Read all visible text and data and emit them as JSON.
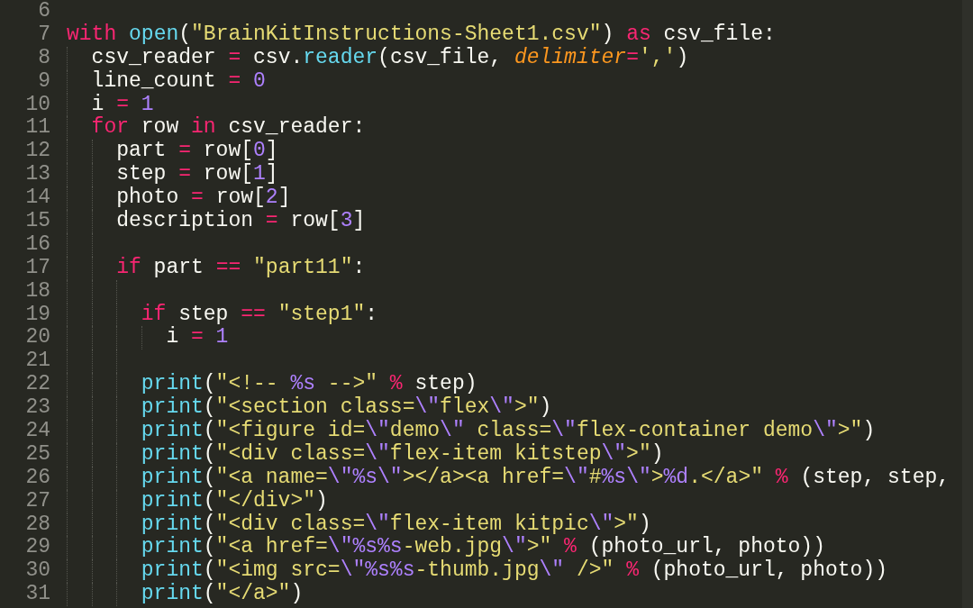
{
  "editor": {
    "lines": [
      {
        "number": "6"
      },
      {
        "number": "7",
        "tokens": [
          {
            "kind": "kw",
            "text": "with"
          },
          {
            "kind": "fn",
            "text": " open"
          },
          {
            "kind": "plain",
            "text": "("
          },
          {
            "kind": "str",
            "text": "\"BrainKitInstructions-Sheet1.csv\""
          },
          {
            "kind": "plain",
            "text": ") "
          },
          {
            "kind": "kw",
            "text": "as"
          },
          {
            "kind": "plain",
            "text": " csv_file:"
          }
        ],
        "children": [
          {
            "number": "8",
            "tokens": [
              {
                "kind": "plain",
                "text": "csv_reader "
              },
              {
                "kind": "kw",
                "text": "="
              },
              {
                "kind": "plain",
                "text": " csv."
              },
              {
                "kind": "fn",
                "text": "reader"
              },
              {
                "kind": "plain",
                "text": "(csv_file, "
              },
              {
                "kind": "param",
                "text": "delimiter"
              },
              {
                "kind": "kw",
                "text": "="
              },
              {
                "kind": "str",
                "text": "','"
              },
              {
                "kind": "plain",
                "text": ")"
              }
            ]
          },
          {
            "number": "9",
            "tokens": [
              {
                "kind": "plain",
                "text": "line_count "
              },
              {
                "kind": "kw",
                "text": "="
              },
              {
                "kind": "num",
                "text": " 0"
              }
            ]
          },
          {
            "number": "10",
            "tokens": [
              {
                "kind": "plain",
                "text": "i "
              },
              {
                "kind": "kw",
                "text": "="
              },
              {
                "kind": "num",
                "text": " 1"
              }
            ]
          },
          {
            "number": "11",
            "tokens": [
              {
                "kind": "kw",
                "text": "for"
              },
              {
                "kind": "plain",
                "text": " row "
              },
              {
                "kind": "kw",
                "text": "in"
              },
              {
                "kind": "plain",
                "text": " csv_reader:"
              }
            ],
            "children": [
              {
                "number": "12",
                "tokens": [
                  {
                    "kind": "plain",
                    "text": "part "
                  },
                  {
                    "kind": "kw",
                    "text": "="
                  },
                  {
                    "kind": "plain",
                    "text": " row["
                  },
                  {
                    "kind": "num",
                    "text": "0"
                  },
                  {
                    "kind": "plain",
                    "text": "]"
                  }
                ]
              },
              {
                "number": "13",
                "tokens": [
                  {
                    "kind": "plain",
                    "text": "step "
                  },
                  {
                    "kind": "kw",
                    "text": "="
                  },
                  {
                    "kind": "plain",
                    "text": " row["
                  },
                  {
                    "kind": "num",
                    "text": "1"
                  },
                  {
                    "kind": "plain",
                    "text": "]"
                  }
                ]
              },
              {
                "number": "14",
                "tokens": [
                  {
                    "kind": "plain",
                    "text": "photo "
                  },
                  {
                    "kind": "kw",
                    "text": "="
                  },
                  {
                    "kind": "plain",
                    "text": " row["
                  },
                  {
                    "kind": "num",
                    "text": "2"
                  },
                  {
                    "kind": "plain",
                    "text": "]"
                  }
                ]
              },
              {
                "number": "15",
                "tokens": [
                  {
                    "kind": "plain",
                    "text": "description "
                  },
                  {
                    "kind": "kw",
                    "text": "="
                  },
                  {
                    "kind": "plain",
                    "text": " row["
                  },
                  {
                    "kind": "num",
                    "text": "3"
                  },
                  {
                    "kind": "plain",
                    "text": "]"
                  }
                ]
              },
              {
                "number": "16"
              },
              {
                "number": "17",
                "tokens": [
                  {
                    "kind": "kw",
                    "text": "if"
                  },
                  {
                    "kind": "plain",
                    "text": " part "
                  },
                  {
                    "kind": "kw",
                    "text": "=="
                  },
                  {
                    "kind": "str",
                    "text": " \"part11\""
                  },
                  {
                    "kind": "plain",
                    "text": ":"
                  }
                ],
                "children": [
                  {
                    "number": "18"
                  },
                  {
                    "number": "19",
                    "tokens": [
                      {
                        "kind": "kw",
                        "text": "if"
                      },
                      {
                        "kind": "plain",
                        "text": " step "
                      },
                      {
                        "kind": "kw",
                        "text": "=="
                      },
                      {
                        "kind": "str",
                        "text": " \"step1\""
                      },
                      {
                        "kind": "plain",
                        "text": ":"
                      }
                    ],
                    "children": [
                      {
                        "number": "20",
                        "tokens": [
                          {
                            "kind": "plain",
                            "text": "i "
                          },
                          {
                            "kind": "kw",
                            "text": "="
                          },
                          {
                            "kind": "num",
                            "text": " 1"
                          }
                        ]
                      }
                    ]
                  },
                  {
                    "number": "21"
                  },
                  {
                    "number": "22",
                    "tokens": [
                      {
                        "kind": "fn",
                        "text": "print"
                      },
                      {
                        "kind": "plain",
                        "text": "("
                      },
                      {
                        "kind": "str",
                        "text": "\"<!-- "
                      },
                      {
                        "kind": "num",
                        "text": "%s"
                      },
                      {
                        "kind": "str",
                        "text": " -->\""
                      },
                      {
                        "kind": "kw",
                        "text": " %"
                      },
                      {
                        "kind": "plain",
                        "text": " step)"
                      }
                    ]
                  },
                  {
                    "number": "23",
                    "tokens": [
                      {
                        "kind": "fn",
                        "text": "print"
                      },
                      {
                        "kind": "plain",
                        "text": "("
                      },
                      {
                        "kind": "str",
                        "text": "\"<section class="
                      },
                      {
                        "kind": "num",
                        "text": "\\\""
                      },
                      {
                        "kind": "str",
                        "text": "flex"
                      },
                      {
                        "kind": "num",
                        "text": "\\\""
                      },
                      {
                        "kind": "str",
                        "text": ">\""
                      },
                      {
                        "kind": "plain",
                        "text": ")"
                      }
                    ]
                  },
                  {
                    "number": "24",
                    "tokens": [
                      {
                        "kind": "fn",
                        "text": "print"
                      },
                      {
                        "kind": "plain",
                        "text": "("
                      },
                      {
                        "kind": "str",
                        "text": "\"<figure id="
                      },
                      {
                        "kind": "num",
                        "text": "\\\""
                      },
                      {
                        "kind": "str",
                        "text": "demo"
                      },
                      {
                        "kind": "num",
                        "text": "\\\""
                      },
                      {
                        "kind": "str",
                        "text": " class="
                      },
                      {
                        "kind": "num",
                        "text": "\\\""
                      },
                      {
                        "kind": "str",
                        "text": "flex-container demo"
                      },
                      {
                        "kind": "num",
                        "text": "\\\""
                      },
                      {
                        "kind": "str",
                        "text": ">\""
                      },
                      {
                        "kind": "plain",
                        "text": ")"
                      }
                    ]
                  },
                  {
                    "number": "25",
                    "tokens": [
                      {
                        "kind": "fn",
                        "text": "print"
                      },
                      {
                        "kind": "plain",
                        "text": "("
                      },
                      {
                        "kind": "str",
                        "text": "\"<div class="
                      },
                      {
                        "kind": "num",
                        "text": "\\\""
                      },
                      {
                        "kind": "str",
                        "text": "flex-item kitstep"
                      },
                      {
                        "kind": "num",
                        "text": "\\\""
                      },
                      {
                        "kind": "str",
                        "text": ">\""
                      },
                      {
                        "kind": "plain",
                        "text": ")"
                      }
                    ]
                  },
                  {
                    "number": "26",
                    "tokens": [
                      {
                        "kind": "fn",
                        "text": "print"
                      },
                      {
                        "kind": "plain",
                        "text": "("
                      },
                      {
                        "kind": "str",
                        "text": "\"<a name="
                      },
                      {
                        "kind": "num",
                        "text": "\\\"%s\\\""
                      },
                      {
                        "kind": "str",
                        "text": "></a><a href="
                      },
                      {
                        "kind": "num",
                        "text": "\\\""
                      },
                      {
                        "kind": "str",
                        "text": "#"
                      },
                      {
                        "kind": "num",
                        "text": "%s\\\""
                      },
                      {
                        "kind": "str",
                        "text": ">"
                      },
                      {
                        "kind": "num",
                        "text": "%d"
                      },
                      {
                        "kind": "str",
                        "text": ".</a>\""
                      },
                      {
                        "kind": "kw",
                        "text": " %"
                      },
                      {
                        "kind": "plain",
                        "text": " (step, step,"
                      }
                    ]
                  },
                  {
                    "number": "27",
                    "tokens": [
                      {
                        "kind": "fn",
                        "text": "print"
                      },
                      {
                        "kind": "plain",
                        "text": "("
                      },
                      {
                        "kind": "str",
                        "text": "\"</div>\""
                      },
                      {
                        "kind": "plain",
                        "text": ")"
                      }
                    ]
                  },
                  {
                    "number": "28",
                    "tokens": [
                      {
                        "kind": "fn",
                        "text": "print"
                      },
                      {
                        "kind": "plain",
                        "text": "("
                      },
                      {
                        "kind": "str",
                        "text": "\"<div class="
                      },
                      {
                        "kind": "num",
                        "text": "\\\""
                      },
                      {
                        "kind": "str",
                        "text": "flex-item kitpic"
                      },
                      {
                        "kind": "num",
                        "text": "\\\""
                      },
                      {
                        "kind": "str",
                        "text": ">\""
                      },
                      {
                        "kind": "plain",
                        "text": ")"
                      }
                    ]
                  },
                  {
                    "number": "29",
                    "tokens": [
                      {
                        "kind": "fn",
                        "text": "print"
                      },
                      {
                        "kind": "plain",
                        "text": "("
                      },
                      {
                        "kind": "str",
                        "text": "\"<a href="
                      },
                      {
                        "kind": "num",
                        "text": "\\\"%s%s"
                      },
                      {
                        "kind": "str",
                        "text": "-web.jpg"
                      },
                      {
                        "kind": "num",
                        "text": "\\\""
                      },
                      {
                        "kind": "str",
                        "text": ">\""
                      },
                      {
                        "kind": "kw",
                        "text": " %"
                      },
                      {
                        "kind": "plain",
                        "text": " (photo_url, photo))"
                      }
                    ]
                  },
                  {
                    "number": "30",
                    "tokens": [
                      {
                        "kind": "fn",
                        "text": "print"
                      },
                      {
                        "kind": "plain",
                        "text": "("
                      },
                      {
                        "kind": "str",
                        "text": "\"<img src="
                      },
                      {
                        "kind": "num",
                        "text": "\\\"%s%s"
                      },
                      {
                        "kind": "str",
                        "text": "-thumb.jpg"
                      },
                      {
                        "kind": "num",
                        "text": "\\\""
                      },
                      {
                        "kind": "str",
                        "text": " />\""
                      },
                      {
                        "kind": "kw",
                        "text": " %"
                      },
                      {
                        "kind": "plain",
                        "text": " (photo_url, photo))"
                      }
                    ]
                  },
                  {
                    "number": "31",
                    "tokens": [
                      {
                        "kind": "fn",
                        "text": "print"
                      },
                      {
                        "kind": "plain",
                        "text": "("
                      },
                      {
                        "kind": "str",
                        "text": "\"</a>\""
                      },
                      {
                        "kind": "plain",
                        "text": ")"
                      }
                    ]
                  }
                ]
              }
            ]
          }
        ]
      }
    ]
  }
}
